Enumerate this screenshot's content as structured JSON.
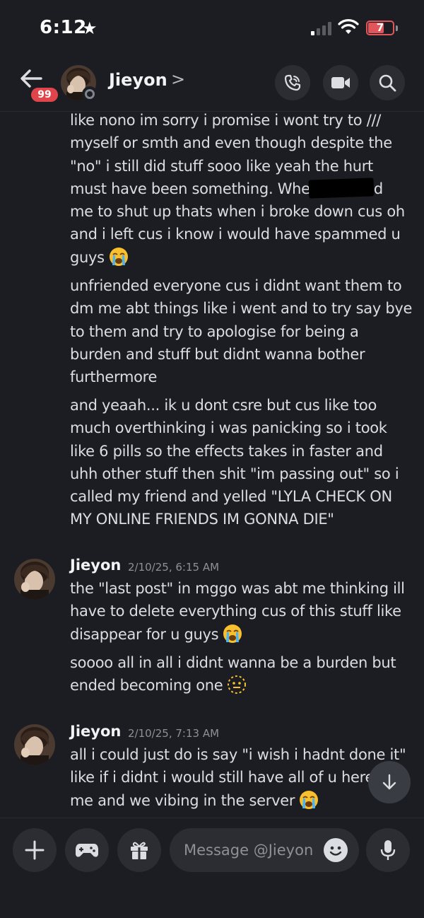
{
  "status_bar": {
    "time": "6:12",
    "battery": "7"
  },
  "header": {
    "badge_count": "99",
    "name": "Jieyon",
    "chevron": ">"
  },
  "messages": {
    "block1_lines": [
      "like nono im sorry i promise i wont try to ///",
      "myself or smth and even though despite the",
      "\"no\" i still did stuff sooo like yeah the hurt",
      "must have been something. Whe",
      "me to shut up thats when i broke down cus oh",
      "and i left cus i know i would have spammed u",
      "guys"
    ],
    "block1_after_redact": "d",
    "block2_lines": [
      "unfriended everyone cus i didnt want them to",
      "dm me abt things like i went and to try say bye",
      "to them and try to apologise for being a",
      "burden and stuff but didnt wanna bother",
      "furthermore"
    ],
    "block3_lines": [
      "and yeaah... ik u dont csre but cus like too",
      "much overthinking i was panicking so i took",
      "like 6 pills so the effects takes in faster and",
      "uhh other stuff then shit \"im passing out\" so i",
      "called my friend and yelled \"LYLA CHECK ON",
      "MY ONLINE FRIENDS IM GONNA DIE\""
    ],
    "group2": {
      "author": "Jieyon",
      "timestamp": "2/10/25, 6:15 AM",
      "block1_lines": [
        "the \"last post\" in mggo was abt me thinking ill",
        "have to delete everything cus of this stuff like",
        "disappear for u guys"
      ],
      "block2_lines": [
        "soooo all in all i didnt wanna be a burden but",
        "ended becoming one"
      ]
    },
    "group3": {
      "author": "Jieyon",
      "timestamp": "2/10/25, 7:13 AM",
      "lines": [
        "all i could just do is say \"i wish i hadnt done it\"",
        "like if i didnt i would still have all of u here",
        "me and we vibing in the server"
      ]
    }
  },
  "composer": {
    "placeholder": "Message @Jieyon"
  },
  "colors": {
    "background": "#1c1d22",
    "badge": "#e0454c",
    "button": "#2c2d33",
    "battery": "#e0565a"
  },
  "icons": [
    "back-arrow-icon",
    "call-icon",
    "video-icon",
    "search-icon",
    "plus-icon",
    "gamepad-icon",
    "gift-icon",
    "emoji-icon",
    "microphone-icon",
    "arrow-down-icon",
    "loudly-crying-emoji",
    "dotted-neutral-emoji"
  ]
}
